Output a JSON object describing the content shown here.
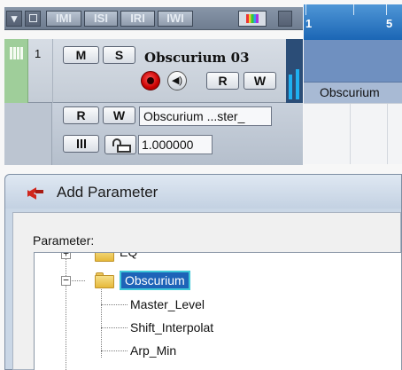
{
  "toolbar": {
    "buttons": [
      "IMI",
      "ISI",
      "IRI",
      "IWI"
    ]
  },
  "ruler": {
    "marks": [
      "1",
      "5"
    ]
  },
  "track": {
    "number": "1",
    "name": "Obscurium 03",
    "mute_label": "M",
    "solo_label": "S",
    "read_label": "R",
    "write_label": "W"
  },
  "event": {
    "label": "Obscurium"
  },
  "automation": {
    "read_label": "R",
    "write_label": "W",
    "parameter": "Obscurium ...ster_",
    "value": "1.000000"
  },
  "dialog": {
    "title": "Add Parameter",
    "parameter_label": "Parameter:",
    "tree": {
      "partial_top_item": "EQ",
      "folder": "Obscurium",
      "children": [
        "Master_Level",
        "Shift_Interpolat",
        "Arp_Min"
      ]
    }
  },
  "colors": {
    "track_green": "#9fce9a",
    "ruler_blue": "#1b66b5",
    "record_red": "#d0261c",
    "selection_blue": "#1e63b8",
    "selection_outline": "#3ec8d8"
  }
}
